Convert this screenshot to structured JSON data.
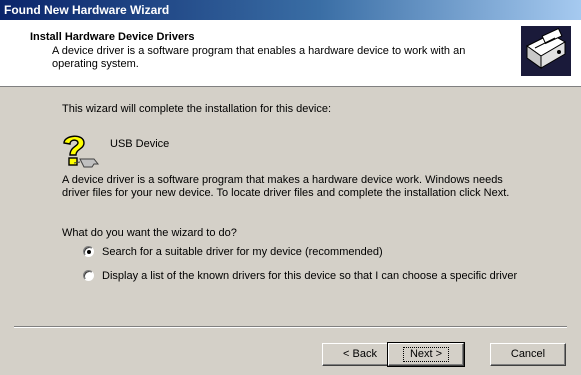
{
  "window": {
    "title": "Found New Hardware Wizard"
  },
  "header": {
    "title": "Install Hardware Device Drivers",
    "subtitle": "A device driver is a software program that enables a hardware device to work with an operating system.",
    "icon": "hardware-wizard-icon"
  },
  "body": {
    "intro": "This wizard will complete the installation for this device:",
    "device_name": "USB Device",
    "device_icon": "unknown-device-question-icon",
    "description": "A device driver is a software program that makes a hardware device work. Windows needs driver files for your new device. To locate driver files and complete the installation click Next.",
    "question": "What do you want the wizard to do?",
    "options": [
      {
        "label": "Search for a suitable driver for my device (recommended)",
        "selected": true
      },
      {
        "label": "Display a list of the known drivers for this device so that I can choose a specific driver",
        "selected": false
      }
    ]
  },
  "buttons": {
    "back": "< Back",
    "next": "Next >",
    "cancel": "Cancel"
  },
  "colors": {
    "titlebar_start": "#0a246a",
    "titlebar_end": "#a6caf0",
    "face": "#d4d0c8"
  }
}
